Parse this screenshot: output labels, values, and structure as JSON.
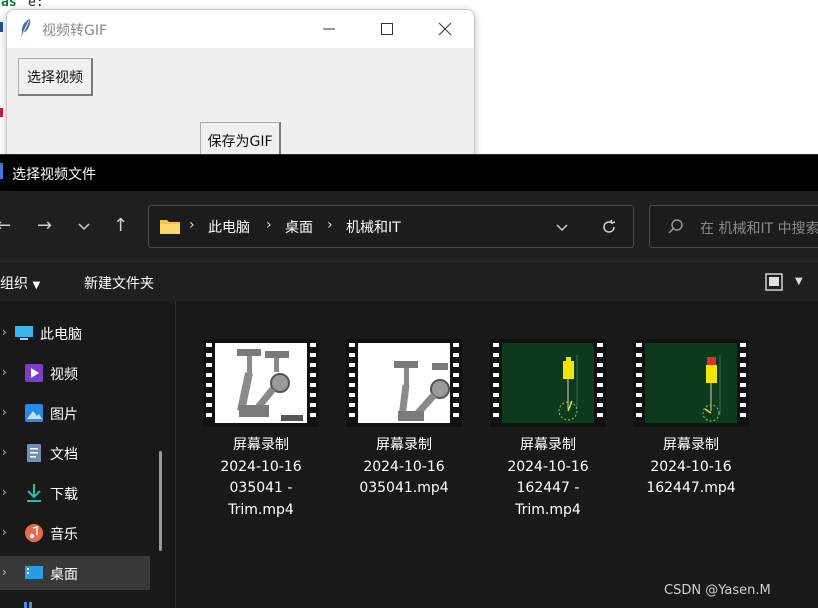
{
  "editor_snippet": {
    "keyword": "as",
    "variable": "e:"
  },
  "app_window": {
    "title": "视频转GIF",
    "select_button": "选择视频",
    "save_button": "保存为GIF",
    "controls": [
      "minimize-icon",
      "maximize-icon",
      "close-icon"
    ]
  },
  "dialog": {
    "title": "选择视频文件",
    "breadcrumb": [
      "此电脑",
      "桌面",
      "机械和IT"
    ],
    "search_placeholder": "在 机械和IT 中搜索",
    "commands": {
      "organize": "组织",
      "new_folder": "新建文件夹"
    },
    "sidebar": [
      {
        "label": "此电脑",
        "icon": "computer-icon",
        "selected": false
      },
      {
        "label": "视频",
        "icon": "video-folder-icon",
        "selected": false
      },
      {
        "label": "图片",
        "icon": "pictures-folder-icon",
        "selected": false
      },
      {
        "label": "文档",
        "icon": "documents-folder-icon",
        "selected": false
      },
      {
        "label": "下载",
        "icon": "download-icon",
        "selected": false
      },
      {
        "label": "音乐",
        "icon": "music-icon",
        "selected": false
      },
      {
        "label": "桌面",
        "icon": "desktop-icon",
        "selected": true
      }
    ],
    "files": [
      {
        "name_lines": [
          "屏幕录制",
          "2024-10-16",
          "035041 -",
          "Trim.mp4"
        ],
        "thumb": "mechanism-light"
      },
      {
        "name_lines": [
          "屏幕录制",
          "2024-10-16",
          "035041.mp4"
        ],
        "thumb": "mechanism-light"
      },
      {
        "name_lines": [
          "屏幕录制",
          "2024-10-16",
          "162447 -",
          "Trim.mp4"
        ],
        "thumb": "sim-dark-green"
      },
      {
        "name_lines": [
          "屏幕录制",
          "2024-10-16",
          "162447.mp4"
        ],
        "thumb": "sim-dark-green-red"
      }
    ]
  },
  "watermark": "CSDN @Yasen.M",
  "colors": {
    "dialog_bg": "#191919",
    "title_bar": "#000000",
    "folder": "#f3c44a",
    "selected_item": "#383838"
  }
}
